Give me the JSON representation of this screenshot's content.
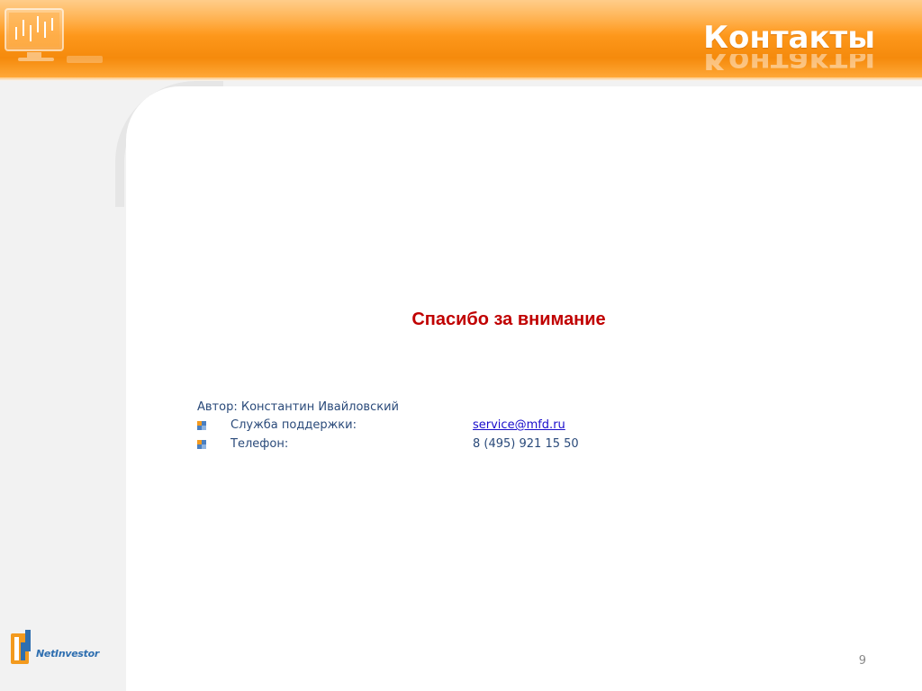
{
  "slide": {
    "title": "Контакты",
    "page_number": "9"
  },
  "content": {
    "thanks": "Спасибо за внимание",
    "author": "Автор: Константин Ивайловский",
    "contacts": [
      {
        "label": "Служба поддержки:",
        "value": "service@mfd.ru",
        "is_link": true
      },
      {
        "label": "Телефон:",
        "value": "8 (495) 921 15 50",
        "is_link": false
      }
    ]
  },
  "footer": {
    "logo_text": "NetInvestor",
    "logo_icon": "netinvestor-logo-icon"
  },
  "colors": {
    "header_orange": "#ff9a1e",
    "title_white": "#ffffff",
    "thanks_red": "#c00000",
    "body_text": "#2a4a7a",
    "link_blue": "#1a0dcc"
  }
}
